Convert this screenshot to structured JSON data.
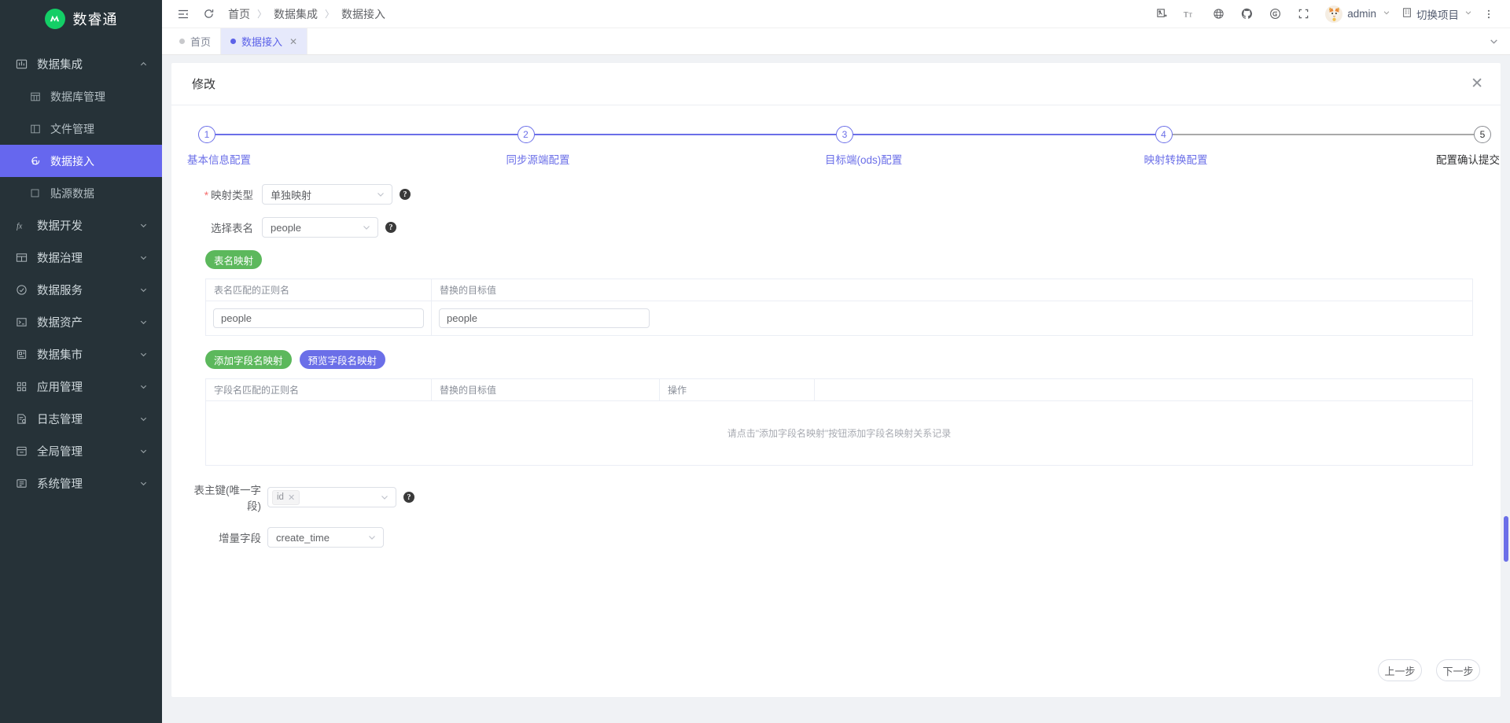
{
  "brand": {
    "title": "数睿通",
    "logo_letter": "M",
    "logo_color": "#13ce66"
  },
  "sidebar": {
    "items": [
      {
        "label": "数据集成",
        "icon": "chart-box-icon",
        "level": "top",
        "state": "expanded",
        "arrow": "chevron-up-icon"
      },
      {
        "label": "数据库管理",
        "icon": "grid-table-icon",
        "level": "sub",
        "state": "normal",
        "arrow": ""
      },
      {
        "label": "文件管理",
        "icon": "file-panel-icon",
        "level": "sub",
        "state": "normal",
        "arrow": ""
      },
      {
        "label": "数据接入",
        "icon": "data-intake-icon",
        "level": "sub",
        "state": "active",
        "arrow": ""
      },
      {
        "label": "贴源数据",
        "icon": "square-icon",
        "level": "sub",
        "state": "normal",
        "arrow": ""
      },
      {
        "label": "数据开发",
        "icon": "fx-icon",
        "level": "top",
        "state": "collapsed",
        "arrow": "chevron-down-icon"
      },
      {
        "label": "数据治理",
        "icon": "table-icon",
        "level": "top",
        "state": "collapsed",
        "arrow": "chevron-down-icon"
      },
      {
        "label": "数据服务",
        "icon": "service-circle-icon",
        "level": "top",
        "state": "collapsed",
        "arrow": "chevron-down-icon"
      },
      {
        "label": "数据资产",
        "icon": "terminal-icon",
        "level": "top",
        "state": "collapsed",
        "arrow": "chevron-down-icon"
      },
      {
        "label": "数据集市",
        "icon": "shop-icon",
        "level": "top",
        "state": "collapsed",
        "arrow": "chevron-down-icon"
      },
      {
        "label": "应用管理",
        "icon": "apps-icon",
        "level": "top",
        "state": "collapsed",
        "arrow": "chevron-down-icon"
      },
      {
        "label": "日志管理",
        "icon": "log-icon",
        "level": "top",
        "state": "collapsed",
        "arrow": "chevron-down-icon"
      },
      {
        "label": "全局管理",
        "icon": "global-icon",
        "level": "top",
        "state": "collapsed",
        "arrow": "chevron-down-icon"
      },
      {
        "label": "系统管理",
        "icon": "system-icon",
        "level": "top",
        "state": "collapsed",
        "arrow": "chevron-down-icon"
      }
    ]
  },
  "topbar": {
    "collapse_icon": "menu-fold-icon",
    "refresh_icon": "refresh-icon",
    "breadcrumb": [
      "首页",
      "数据集成",
      "数据接入"
    ],
    "right_icons": [
      "screenshot-icon",
      "font-size-icon",
      "globe-icon",
      "github-icon",
      "gitee-icon",
      "fullscreen-icon"
    ],
    "user": {
      "name": "admin",
      "avatar_icon": "cat-avatar"
    },
    "project_switch": {
      "label": "切换项目",
      "icon": "building-icon"
    },
    "more_icon": "more-vertical-icon"
  },
  "tabs": [
    {
      "label": "首页",
      "active": false,
      "closable": false
    },
    {
      "label": "数据接入",
      "active": true,
      "closable": true,
      "close_label": "✕"
    }
  ],
  "modal": {
    "title": "修改",
    "close_label": "✕"
  },
  "steps": [
    {
      "num": "1",
      "label": "基本信息配置",
      "active": true
    },
    {
      "num": "2",
      "label": "同步源端配置",
      "active": true
    },
    {
      "num": "3",
      "label": "目标端(ods)配置",
      "active": true
    },
    {
      "num": "4",
      "label": "映射转换配置",
      "active": true
    },
    {
      "num": "5",
      "label": "配置确认提交",
      "active": false
    }
  ],
  "form": {
    "mapping_type": {
      "label": "映射类型",
      "required": true,
      "value": "单独映射",
      "help": "?"
    },
    "table_name": {
      "label": "选择表名",
      "required": false,
      "value": "people",
      "help": "?"
    },
    "table_mapping_btn": "表名映射",
    "table_mapping_table": {
      "headers": [
        "表名匹配的正则名",
        "替换的目标值"
      ],
      "rows": [
        {
          "regex": "people",
          "target": "people"
        }
      ]
    },
    "add_field_mapping_btn": "添加字段名映射",
    "preview_field_mapping_btn": "预览字段名映射",
    "field_mapping_table": {
      "headers": [
        "字段名匹配的正则名",
        "替换的目标值",
        "操作"
      ],
      "empty_text": "请点击\"添加字段名映射\"按钮添加字段名映射关系记录",
      "rows": []
    },
    "primary_key": {
      "label": "表主键(唯一字段)",
      "tags": [
        "id"
      ],
      "help": "?"
    },
    "incr_field": {
      "label": "增量字段",
      "value": "create_time"
    }
  },
  "footer": {
    "prev": "上一步",
    "next": "下一步"
  },
  "colors": {
    "accent": "#6b6fe8",
    "sidebar_bg": "#263238",
    "active_nav": "#6667ee",
    "green": "#5cb85c"
  }
}
